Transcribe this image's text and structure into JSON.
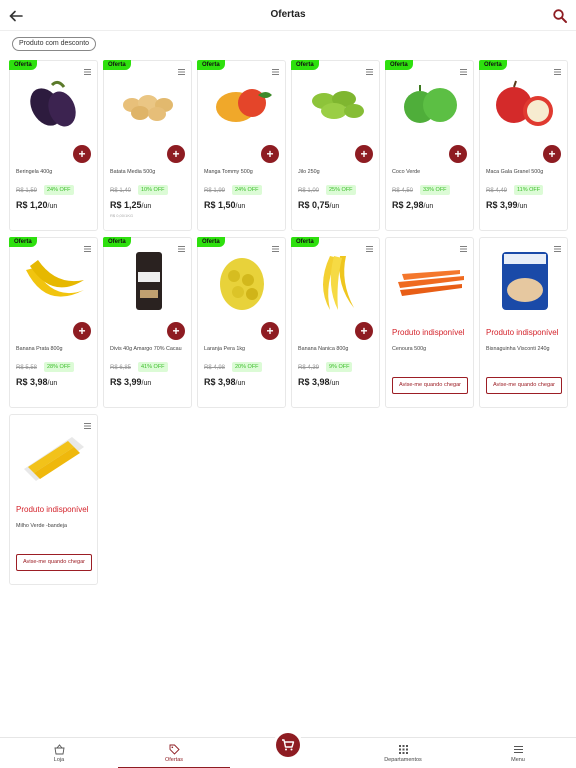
{
  "header": {
    "title": "Ofertas",
    "back_icon": "arrow-left-icon",
    "search_icon": "search-icon"
  },
  "filter": {
    "label": "Produto com desconto"
  },
  "colors": {
    "accent": "#8e1c22",
    "badge": "#2ee00e",
    "off_text": "#3bbd2a",
    "unavailable": "#d4232b"
  },
  "products": [
    {
      "badge": "Oferta",
      "name": "Beringela 400g",
      "old_price": "R$ 1,59",
      "off": "24% OFF",
      "price": "R$ 1,20",
      "unit": "/un"
    },
    {
      "badge": "Oferta",
      "name": "Batata Media 500g",
      "old_price": "R$ 1,40",
      "off": "10% OFF",
      "price": "R$ 1,25",
      "unit": "/un",
      "note": "R$ 0,00/1KG"
    },
    {
      "badge": "Oferta",
      "name": "Manga Tommy 500g",
      "old_price": "R$ 1,99",
      "off": "24% OFF",
      "price": "R$ 1,50",
      "unit": "/un"
    },
    {
      "badge": "Oferta",
      "name": "Jilo 250g",
      "old_price": "R$ 1,00",
      "off": "25% OFF",
      "price": "R$ 0,75",
      "unit": "/un"
    },
    {
      "badge": "Oferta",
      "name": "Coco Verde",
      "old_price": "R$ 4,50",
      "off": "33% OFF",
      "price": "R$ 2,98",
      "unit": "/un"
    },
    {
      "badge": "Oferta",
      "name": "Maca Gala Granel 500g",
      "old_price": "R$ 4,49",
      "off": "11% OFF",
      "price": "R$ 3,99",
      "unit": "/un"
    },
    {
      "badge": "Oferta",
      "name": "Banana Prata 800g",
      "old_price": "R$ 5,58",
      "off": "28% OFF",
      "price": "R$ 3,98",
      "unit": "/un"
    },
    {
      "badge": "Oferta",
      "name": "Divis 40g Amargo 70% Cacau",
      "old_price": "R$ 6,85",
      "off": "41% OFF",
      "price": "R$ 3,99",
      "unit": "/un"
    },
    {
      "badge": "Oferta",
      "name": "Laranja Pera 1kg",
      "old_price": "R$ 4,98",
      "off": "20% OFF",
      "price": "R$ 3,98",
      "unit": "/un"
    },
    {
      "badge": "Oferta",
      "name": "Banana Nanica 800g",
      "old_price": "R$ 4,39",
      "off": "9% OFF",
      "price": "R$ 3,98",
      "unit": "/un"
    },
    {
      "name": "Cenoura 500g",
      "unavailable": "Produto indisponível",
      "notify": "Avise-me quando chegar"
    },
    {
      "name": "Bisnaguinha Visconti 240g",
      "unavailable": "Produto indisponível",
      "notify": "Avise-me quando chegar"
    },
    {
      "name": "Milho Verde -bandeja",
      "unavailable": "Produto indisponível",
      "notify": "Avise-me quando chegar"
    }
  ],
  "nav": {
    "items": [
      {
        "label": "Loja",
        "icon": "basket-icon"
      },
      {
        "label": "Ofertas",
        "icon": "tag-icon",
        "active": true
      },
      {
        "label": "Departamentos",
        "icon": "grid-icon"
      },
      {
        "label": "Menu",
        "icon": "menu-icon"
      }
    ],
    "cart_icon": "cart-icon"
  }
}
